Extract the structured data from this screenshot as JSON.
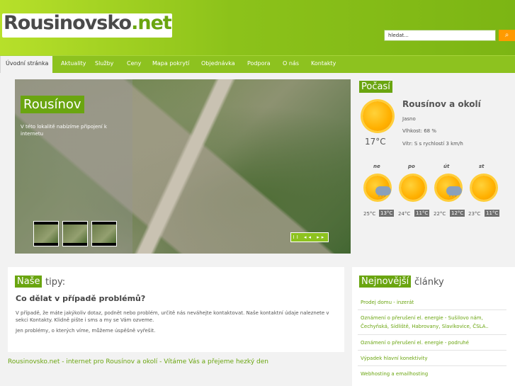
{
  "site": {
    "logo_text": "Rousinovsko",
    "logo_tld": ".net"
  },
  "search": {
    "placeholder": "hledat...",
    "button_icon": "search-icon"
  },
  "nav": [
    {
      "label": "Úvodní stránka"
    },
    {
      "label": "Aktuality"
    },
    {
      "label": "Služby"
    },
    {
      "label": "Ceny"
    },
    {
      "label": "Mapa pokrytí"
    },
    {
      "label": "Objednávka"
    },
    {
      "label": "Podpora"
    },
    {
      "label": "O nás"
    },
    {
      "label": "Kontakty"
    }
  ],
  "hero": {
    "title": "Rousínov",
    "description": "V této lokalitě nabízíme připojení k internetu",
    "controls": "II ◂◂ ▸▸"
  },
  "weather": {
    "label": "Počasí",
    "location": "Rousínov a okolí",
    "condition": "Jasno",
    "humidity": "Vlhkost: 68 %",
    "wind": "Vítr: S s rychlostí 3 km/h",
    "temp": "17°C",
    "forecast": [
      {
        "day": "ne",
        "low": "25°C",
        "high": "13°C",
        "icon": "sun-rain-icon"
      },
      {
        "day": "po",
        "low": "24°C",
        "high": "11°C",
        "icon": "sun-icon"
      },
      {
        "day": "út",
        "low": "22°C",
        "high": "12°C",
        "icon": "sun-rain-icon"
      },
      {
        "day": "st",
        "low": "23°C",
        "high": "11°C",
        "icon": "sun-icon"
      }
    ]
  },
  "tips": {
    "label_highlight": "Naše",
    "label_rest": "tipy:",
    "heading": "Co dělat v případě problémů?",
    "para1": "V případě, že máte jakýkoliv dotaz, podnět nebo problém, určitě nás neváhejte kontaktovat. Naše kontaktní údaje naleznete v sekci Kontakty. Klidně pište i sms a my se Vám ozveme.",
    "para2": "Jen problémy, o kterých víme, můžeme úspěšně vyřešit."
  },
  "tagline": "Rousinovsko.net - internet pro Rousínov a okolí - Vítáme Vás a přejeme hezký den",
  "articles": {
    "label_highlight": "Nejnovější",
    "label_rest": "články",
    "items": [
      "Prodej domu - inzerát",
      "Oznámení o přerušení el. energie - Sušilovo nám, Čechyňská, Sídliště, Habrovany, Slavíkovice, ČSLA..",
      "Oznámení o přerušení el. energie - podruhé",
      "Výpadek hlavní konektivity",
      "Webhosting a emailhosting"
    ]
  }
}
